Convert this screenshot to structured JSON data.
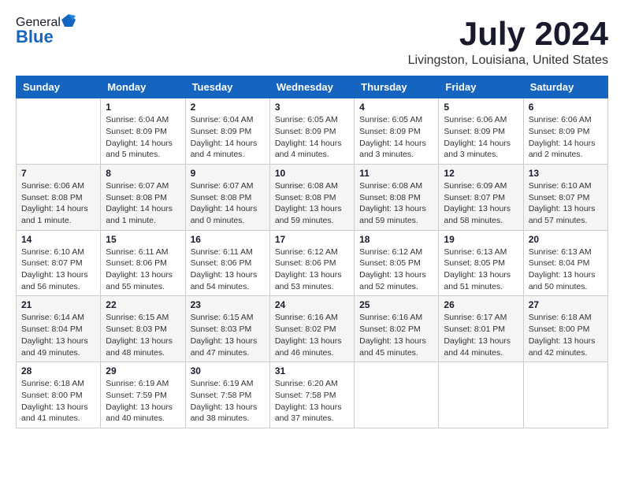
{
  "header": {
    "logo_general": "General",
    "logo_blue": "Blue",
    "title": "July 2024",
    "subtitle": "Livingston, Louisiana, United States"
  },
  "calendar": {
    "days_of_week": [
      "Sunday",
      "Monday",
      "Tuesday",
      "Wednesday",
      "Thursday",
      "Friday",
      "Saturday"
    ],
    "weeks": [
      [
        {
          "day": "",
          "detail": ""
        },
        {
          "day": "1",
          "detail": "Sunrise: 6:04 AM\nSunset: 8:09 PM\nDaylight: 14 hours\nand 5 minutes."
        },
        {
          "day": "2",
          "detail": "Sunrise: 6:04 AM\nSunset: 8:09 PM\nDaylight: 14 hours\nand 4 minutes."
        },
        {
          "day": "3",
          "detail": "Sunrise: 6:05 AM\nSunset: 8:09 PM\nDaylight: 14 hours\nand 4 minutes."
        },
        {
          "day": "4",
          "detail": "Sunrise: 6:05 AM\nSunset: 8:09 PM\nDaylight: 14 hours\nand 3 minutes."
        },
        {
          "day": "5",
          "detail": "Sunrise: 6:06 AM\nSunset: 8:09 PM\nDaylight: 14 hours\nand 3 minutes."
        },
        {
          "day": "6",
          "detail": "Sunrise: 6:06 AM\nSunset: 8:09 PM\nDaylight: 14 hours\nand 2 minutes."
        }
      ],
      [
        {
          "day": "7",
          "detail": "Sunrise: 6:06 AM\nSunset: 8:08 PM\nDaylight: 14 hours\nand 1 minute."
        },
        {
          "day": "8",
          "detail": "Sunrise: 6:07 AM\nSunset: 8:08 PM\nDaylight: 14 hours\nand 1 minute."
        },
        {
          "day": "9",
          "detail": "Sunrise: 6:07 AM\nSunset: 8:08 PM\nDaylight: 14 hours\nand 0 minutes."
        },
        {
          "day": "10",
          "detail": "Sunrise: 6:08 AM\nSunset: 8:08 PM\nDaylight: 13 hours\nand 59 minutes."
        },
        {
          "day": "11",
          "detail": "Sunrise: 6:08 AM\nSunset: 8:08 PM\nDaylight: 13 hours\nand 59 minutes."
        },
        {
          "day": "12",
          "detail": "Sunrise: 6:09 AM\nSunset: 8:07 PM\nDaylight: 13 hours\nand 58 minutes."
        },
        {
          "day": "13",
          "detail": "Sunrise: 6:10 AM\nSunset: 8:07 PM\nDaylight: 13 hours\nand 57 minutes."
        }
      ],
      [
        {
          "day": "14",
          "detail": "Sunrise: 6:10 AM\nSunset: 8:07 PM\nDaylight: 13 hours\nand 56 minutes."
        },
        {
          "day": "15",
          "detail": "Sunrise: 6:11 AM\nSunset: 8:06 PM\nDaylight: 13 hours\nand 55 minutes."
        },
        {
          "day": "16",
          "detail": "Sunrise: 6:11 AM\nSunset: 8:06 PM\nDaylight: 13 hours\nand 54 minutes."
        },
        {
          "day": "17",
          "detail": "Sunrise: 6:12 AM\nSunset: 8:06 PM\nDaylight: 13 hours\nand 53 minutes."
        },
        {
          "day": "18",
          "detail": "Sunrise: 6:12 AM\nSunset: 8:05 PM\nDaylight: 13 hours\nand 52 minutes."
        },
        {
          "day": "19",
          "detail": "Sunrise: 6:13 AM\nSunset: 8:05 PM\nDaylight: 13 hours\nand 51 minutes."
        },
        {
          "day": "20",
          "detail": "Sunrise: 6:13 AM\nSunset: 8:04 PM\nDaylight: 13 hours\nand 50 minutes."
        }
      ],
      [
        {
          "day": "21",
          "detail": "Sunrise: 6:14 AM\nSunset: 8:04 PM\nDaylight: 13 hours\nand 49 minutes."
        },
        {
          "day": "22",
          "detail": "Sunrise: 6:15 AM\nSunset: 8:03 PM\nDaylight: 13 hours\nand 48 minutes."
        },
        {
          "day": "23",
          "detail": "Sunrise: 6:15 AM\nSunset: 8:03 PM\nDaylight: 13 hours\nand 47 minutes."
        },
        {
          "day": "24",
          "detail": "Sunrise: 6:16 AM\nSunset: 8:02 PM\nDaylight: 13 hours\nand 46 minutes."
        },
        {
          "day": "25",
          "detail": "Sunrise: 6:16 AM\nSunset: 8:02 PM\nDaylight: 13 hours\nand 45 minutes."
        },
        {
          "day": "26",
          "detail": "Sunrise: 6:17 AM\nSunset: 8:01 PM\nDaylight: 13 hours\nand 44 minutes."
        },
        {
          "day": "27",
          "detail": "Sunrise: 6:18 AM\nSunset: 8:00 PM\nDaylight: 13 hours\nand 42 minutes."
        }
      ],
      [
        {
          "day": "28",
          "detail": "Sunrise: 6:18 AM\nSunset: 8:00 PM\nDaylight: 13 hours\nand 41 minutes."
        },
        {
          "day": "29",
          "detail": "Sunrise: 6:19 AM\nSunset: 7:59 PM\nDaylight: 13 hours\nand 40 minutes."
        },
        {
          "day": "30",
          "detail": "Sunrise: 6:19 AM\nSunset: 7:58 PM\nDaylight: 13 hours\nand 38 minutes."
        },
        {
          "day": "31",
          "detail": "Sunrise: 6:20 AM\nSunset: 7:58 PM\nDaylight: 13 hours\nand 37 minutes."
        },
        {
          "day": "",
          "detail": ""
        },
        {
          "day": "",
          "detail": ""
        },
        {
          "day": "",
          "detail": ""
        }
      ]
    ]
  }
}
